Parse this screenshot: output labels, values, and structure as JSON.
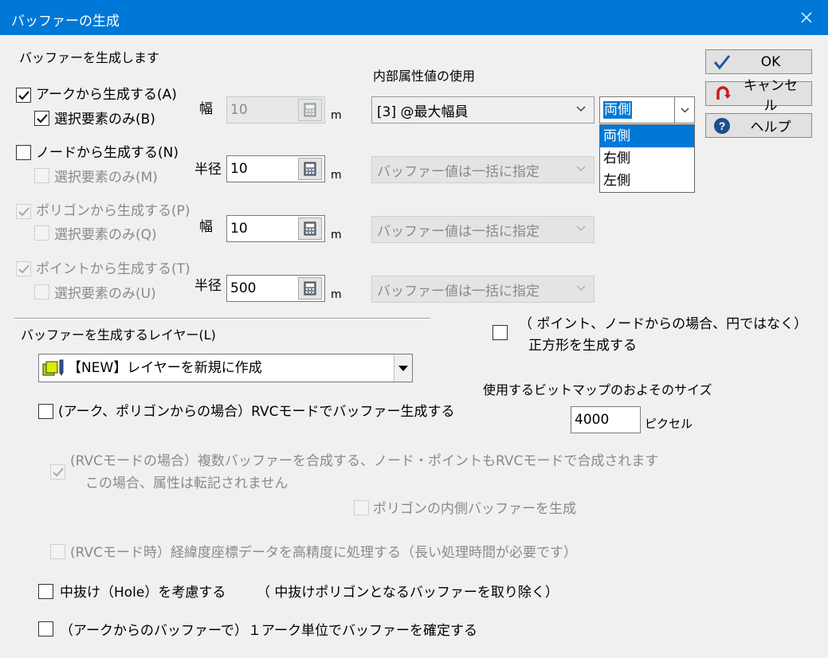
{
  "window": {
    "title": "バッファーの生成"
  },
  "section_top": {
    "heading": "バッファーを生成します"
  },
  "internal_attr": {
    "label": "内部属性値の使用"
  },
  "rows": {
    "arc": {
      "label": "アークから生成する(A)",
      "checked": true,
      "selected_only": "選択要素のみ(B)",
      "selected_only_checked": true,
      "size_label": "幅",
      "value": "10",
      "unit": "m",
      "combo": "[3] @最大幅員"
    },
    "node": {
      "label": "ノードから生成する(N)",
      "checked": false,
      "selected_only": "選択要素のみ(M)",
      "size_label": "半径",
      "value": "10",
      "unit": "m",
      "combo": "バッファー値は一括に指定"
    },
    "polygon": {
      "label": "ポリゴンから生成する(P)",
      "checked": true,
      "selected_only": "選択要素のみ(Q)",
      "size_label": "幅",
      "value": "10",
      "unit": "m",
      "combo": "バッファー値は一括に指定"
    },
    "point": {
      "label": "ポイントから生成する(T)",
      "checked": true,
      "selected_only": "選択要素のみ(U)",
      "size_label": "半径",
      "value": "500",
      "unit": "m",
      "combo": "バッファー値は一括に指定"
    }
  },
  "side_dropdown": {
    "value": "両側",
    "options": [
      "両側",
      "右側",
      "左側"
    ],
    "highlighted": "両側"
  },
  "buttons": {
    "ok": "OK",
    "cancel": "キャンセル",
    "help": "ヘルプ"
  },
  "layer": {
    "label": "バッファーを生成するレイヤー(L)",
    "value": "【NEW】レイヤーを新規に作成"
  },
  "square_option": {
    "line1": "（ ポイント、ノードからの場合、円ではなく）",
    "line2": "正方形を生成する"
  },
  "bitmap": {
    "label": "使用するビットマップのおよそのサイズ",
    "value": "4000",
    "unit": "ピクセル"
  },
  "rvc": {
    "mode": "(アーク、ポリゴンからの場合）RVCモードでバッファー生成する",
    "merge_line1": "(RVCモードの場合）複数バッファーを合成する、ノード・ポイントもRVCモードで合成されます",
    "merge_line2": "この場合、属性は転記されません",
    "inner": "ポリゴンの内側バッファーを生成",
    "precision": "(RVCモード時）経緯度座標データを高精度に処理する（長い処理時間が必要です）"
  },
  "hole": {
    "label": "中抜け（Hole）を考慮する",
    "note": "（ 中抜けポリゴンとなるバッファーを取り除く）"
  },
  "per_arc": {
    "label": "（アークからのバッファーで）１アーク単位でバッファーを確定する"
  }
}
